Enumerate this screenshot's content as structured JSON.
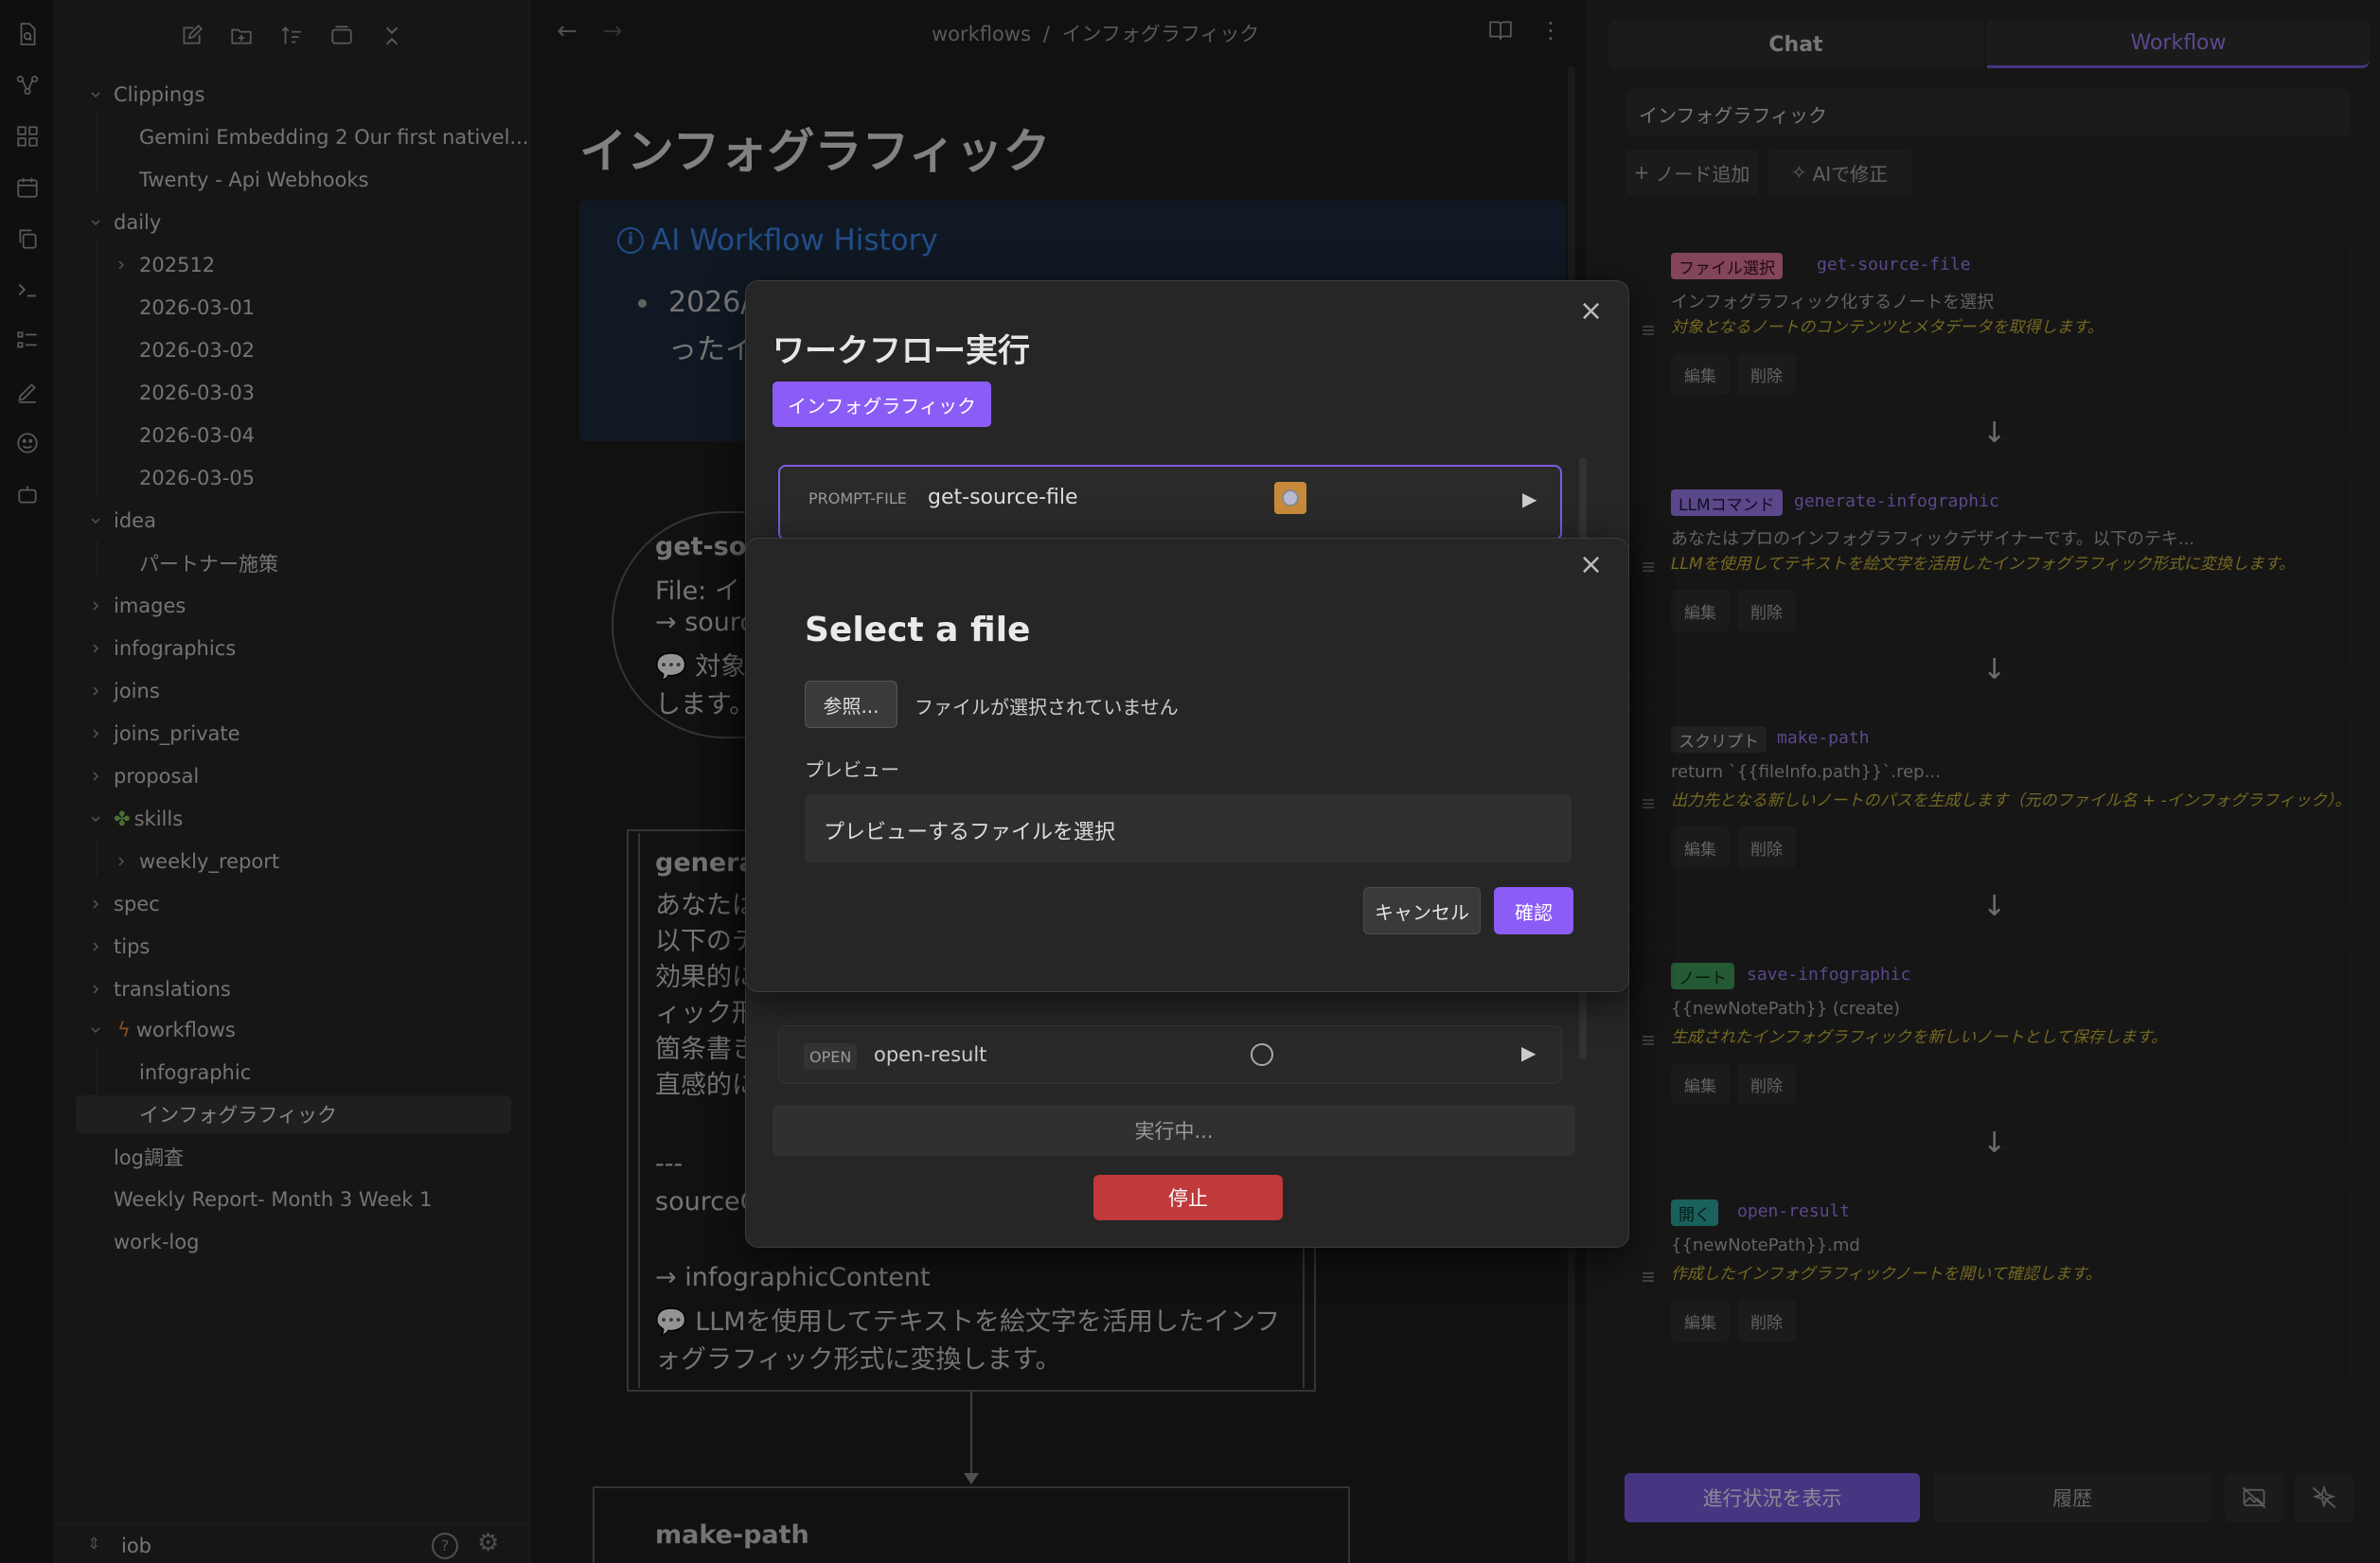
{
  "sidebar": {
    "tree": [
      {
        "label": "Clippings"
      },
      {
        "label": "Gemini Embedding 2 Our first nativel..."
      },
      {
        "label": "Twenty - Api Webhooks"
      },
      {
        "label": "daily"
      },
      {
        "label": "202512"
      },
      {
        "label": "2026-03-01"
      },
      {
        "label": "2026-03-02"
      },
      {
        "label": "2026-03-03"
      },
      {
        "label": "2026-03-04"
      },
      {
        "label": "2026-03-05"
      },
      {
        "label": "idea"
      },
      {
        "label": "パートナー施策"
      },
      {
        "label": "images"
      },
      {
        "label": "infographics"
      },
      {
        "label": "joins"
      },
      {
        "label": "joins_private"
      },
      {
        "label": "proposal"
      },
      {
        "label": "skills"
      },
      {
        "label": "weekly_report"
      },
      {
        "label": "spec"
      },
      {
        "label": "tips"
      },
      {
        "label": "translations"
      },
      {
        "label": "workflows"
      },
      {
        "label": "infographic"
      },
      {
        "label": "インフォグラフィック"
      },
      {
        "label": "log調査"
      },
      {
        "label": "Weekly Report- Month 3 Week 1"
      },
      {
        "label": "work-log"
      }
    ],
    "vault_name": "iob"
  },
  "header": {
    "breadcrumb_parent": "workflows",
    "breadcrumb_sep": "/",
    "breadcrumb_current": "インフォグラフィック"
  },
  "note": {
    "title": "インフォグラフィック",
    "callout_title": "AI Workflow History",
    "callout_line1": "2026/",
    "callout_line2": "ったイン",
    "node1": {
      "title": "get-sour",
      "l1": "File: イ",
      "l2": "→ source",
      "l3": "💬 対象",
      "l4": "します。"
    },
    "node2": {
      "title": "generat",
      "l1": "あなたは",
      "l2": "以下のテ",
      "l3": "効果的に",
      "l4": "ィック形",
      "l5": "箇条書き",
      "l6": "直感的に",
      "l7": "---",
      "l8": "sourceC",
      "l9": "→ infographicContent",
      "l10": "💬 LLMを使用してテキストを絵文字を活用したインフ",
      "l11": "ォグラフィック形式に変換します。"
    },
    "node3": {
      "title": "make-path"
    }
  },
  "right_panel": {
    "tabs": {
      "chat": "Chat",
      "workflow": "Workflow"
    },
    "workflow_select": "インフォグラフィック",
    "add_node": "ノード追加",
    "ai_fix": "AIで修正",
    "edit_label": "編集",
    "delete_label": "削除",
    "arrow": "↓",
    "steps": [
      {
        "type": "ファイル選択",
        "name": "get-source-file",
        "line": "インフォグラフィック化するノートを選択",
        "desc": "対象となるノートのコンテンツとメタデータを取得します。",
        "color": "#e0789a"
      },
      {
        "type": "LLMコマンド",
        "name": "generate-infographic",
        "line": "あなたはプロのインフォグラフィックデザイナーです。以下のテキ...",
        "desc": "LLMを使用してテキストを絵文字を活用したインフォグラフィック形式に変換します。",
        "color": "#9d7cf0"
      },
      {
        "type": "スクリプト",
        "name": "make-path",
        "line": "return `{{fileInfo.path}}`.rep...",
        "desc": "出力先となる新しいノートのパスを生成します（元のファイル名 + -インフォグラフィック）。",
        "color": "#8a8a8a"
      },
      {
        "type": "ノート",
        "name": "save-infographic",
        "line": "{{newNotePath}} (create)",
        "desc": "生成されたインフォグラフィックを新しいノートとして保存します。",
        "color": "#4caf6a"
      },
      {
        "type": "開く",
        "name": "open-result",
        "line": "{{newNotePath}}.md",
        "desc": "作成したインフォグラフィックノートを開いて確認します。",
        "color": "#3cb4a8"
      }
    ],
    "progress_button": "進行状況を表示",
    "history_button": "履歴"
  },
  "run_modal": {
    "title": "ワークフロー実行",
    "workflow_badge": "インフォグラフィック",
    "step1_type": "PROMPT-FILE",
    "step1_name": "get-source-file",
    "step5_type": "OPEN",
    "step5_name": "open-result",
    "running_text": "実行中...",
    "stop_button": "停止"
  },
  "file_modal": {
    "title": "Select a file",
    "browse_button": "参照...",
    "no_file_text": "ファイルが選択されていません",
    "preview_label": "プレビュー",
    "preview_placeholder": "プレビューするファイルを選択",
    "cancel_button": "キャンセル",
    "confirm_button": "確認"
  },
  "colors": {
    "accent": "#8b5cf6",
    "stop": "#c0393b",
    "info_blue": "#2f6fd0"
  }
}
